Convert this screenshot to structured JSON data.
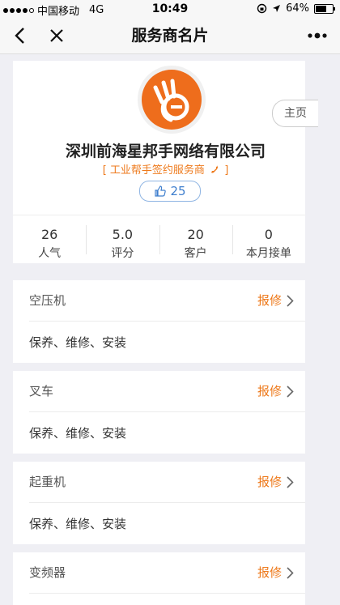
{
  "status_bar": {
    "carrier": "中国移动",
    "network": "4G",
    "time": "10:49",
    "battery": "64%",
    "battery_level": 0.64
  },
  "nav": {
    "title": "服务商名片"
  },
  "profile": {
    "company_name": "深圳前海星邦手网络有限公司",
    "subtitle": "[ 工业帮手签约服务商",
    "subtitle_end": "]",
    "home_label": "主页",
    "likes": "25",
    "brand_color": "#ee6d1c"
  },
  "stats": [
    {
      "value": "26",
      "label": "人气"
    },
    {
      "value": "5.0",
      "label": "评分"
    },
    {
      "value": "20",
      "label": "客户"
    },
    {
      "value": "0",
      "label": "本月接单"
    }
  ],
  "services": [
    {
      "name": "空压机",
      "action": "报修",
      "description": "保养、维修、安装"
    },
    {
      "name": "叉车",
      "action": "报修",
      "description": "保养、维修、安装"
    },
    {
      "name": "起重机",
      "action": "报修",
      "description": "保养、维修、安装"
    },
    {
      "name": "变频器",
      "action": "报修",
      "description": ""
    }
  ]
}
